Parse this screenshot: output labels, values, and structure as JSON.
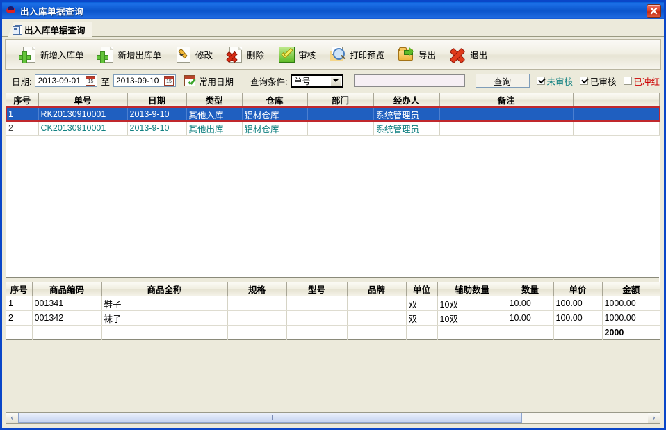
{
  "window": {
    "title": "出入库单据查询",
    "icon": "app-icon",
    "close_label": "×"
  },
  "tab": {
    "label": "出入库单据查询",
    "icon": "document-icon"
  },
  "toolbar": {
    "buttons": [
      {
        "label": "新增入库单",
        "icon": "page-add-icon"
      },
      {
        "label": "新增出库单",
        "icon": "page-add-icon"
      },
      {
        "label": "修改",
        "icon": "pencil-edit-icon"
      },
      {
        "label": "删除",
        "icon": "page-delete-icon"
      },
      {
        "label": "审核",
        "icon": "green-check-icon"
      },
      {
        "label": "打印预览",
        "icon": "print-preview-icon"
      },
      {
        "label": "导出",
        "icon": "export-folder-icon"
      },
      {
        "label": "退出",
        "icon": "red-x-icon"
      }
    ]
  },
  "filter": {
    "date_label": "日期:",
    "date_from": "2013-09-01",
    "date_to": "2013-09-10",
    "between_label": "至",
    "common_date_label": "常用日期",
    "condition_label": "查询条件:",
    "condition_value": "单号",
    "condition_options": [
      "单号"
    ],
    "keyword_value": "",
    "keyword_placeholder": "",
    "query_button": "查询",
    "checkboxes": [
      {
        "label": "未审核",
        "checked": true,
        "color": "#108080"
      },
      {
        "label": "已审核",
        "checked": true,
        "color": "#000000"
      },
      {
        "label": "已冲红",
        "checked": false,
        "color": "#cc0000"
      }
    ]
  },
  "master_grid": {
    "columns": [
      "序号",
      "单号",
      "日期",
      "类型",
      "仓库",
      "部门",
      "经办人",
      "备注",
      ""
    ],
    "rows": [
      {
        "selected": true,
        "cells": [
          "1",
          "RK20130910001",
          "2013-9-10",
          "其他入库",
          "铝材仓库",
          "",
          "系统管理员",
          "",
          ""
        ]
      },
      {
        "selected": false,
        "cells": [
          "2",
          "CK20130910001",
          "2013-9-10",
          "其他出库",
          "铝材仓库",
          "",
          "系统管理员",
          "",
          ""
        ]
      }
    ]
  },
  "detail_grid": {
    "columns": [
      "序号",
      "商品编码",
      "商品全称",
      "规格",
      "型号",
      "品牌",
      "单位",
      "辅助数量",
      "数量",
      "单价",
      "金额"
    ],
    "rows": [
      [
        "1",
        "001341",
        "鞋子",
        "",
        "",
        "",
        "双",
        "10双",
        "10.00",
        "100.00",
        "1000.00"
      ],
      [
        "2",
        "001342",
        "袜子",
        "",
        "",
        "",
        "双",
        "10双",
        "10.00",
        "100.00",
        "1000.00"
      ]
    ],
    "total_row": [
      "",
      "",
      "",
      "",
      "",
      "",
      "",
      "",
      "",
      "",
      "2000"
    ]
  },
  "scrollbar": {
    "left_arrow": "‹",
    "right_arrow": "›"
  },
  "colors": {
    "title_blue": "#0a46c8",
    "selection_blue": "#1f5fc0",
    "selection_outline_red": "#c0282d",
    "teal_text": "#108080",
    "red_text": "#cc0000"
  }
}
